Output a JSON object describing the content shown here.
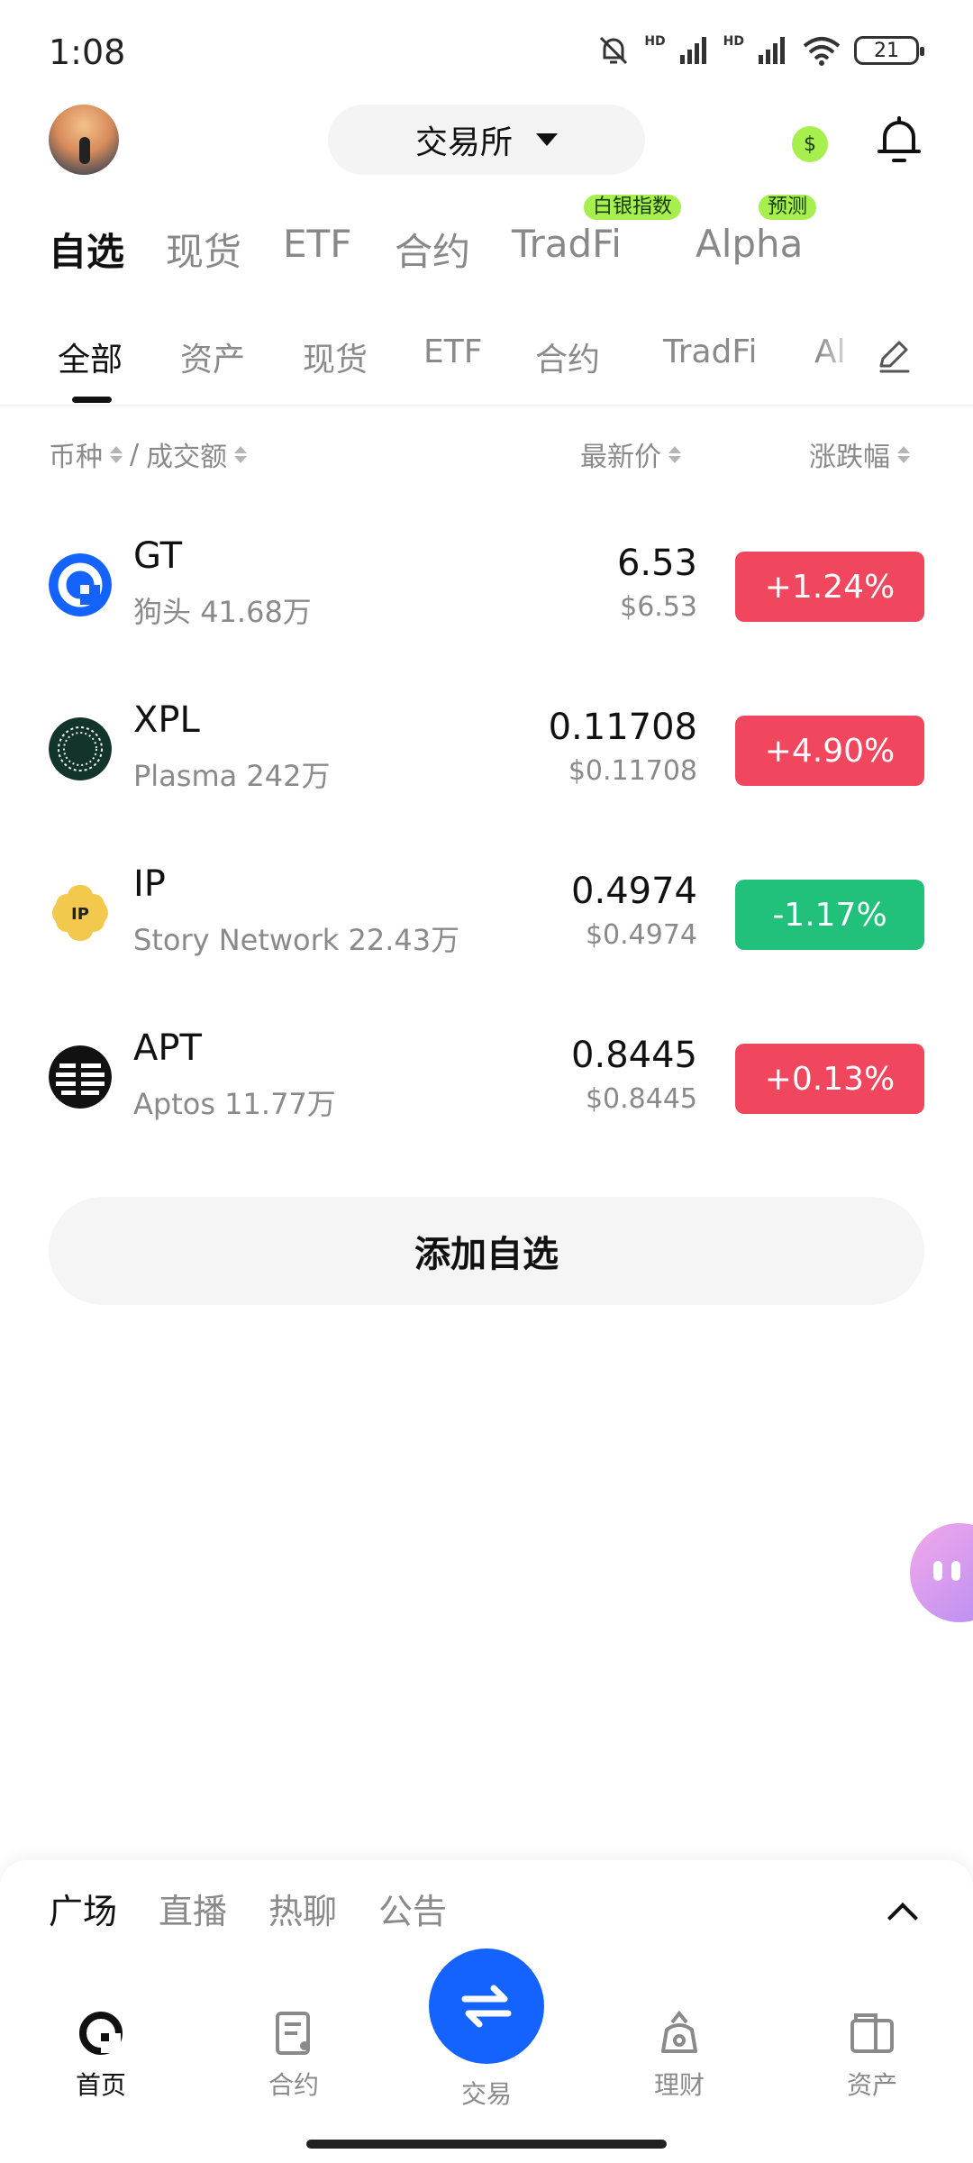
{
  "status_bar": {
    "time": "1:08",
    "battery": "21",
    "icons": [
      "mute-bell-icon",
      "signal-hd-icon",
      "signal-hd-icon",
      "wifi-icon",
      "battery-icon"
    ]
  },
  "header": {
    "exchange_label": "交易所",
    "coin_symbol": "$"
  },
  "primary_tabs": [
    {
      "label": "自选",
      "active": true
    },
    {
      "label": "现货"
    },
    {
      "label": "ETF"
    },
    {
      "label": "合约"
    },
    {
      "label": "TradFi",
      "badge": "白银指数"
    },
    {
      "label": "Alpha",
      "badge": "预测"
    }
  ],
  "secondary_tabs": [
    {
      "label": "全部",
      "active": true
    },
    {
      "label": "资产"
    },
    {
      "label": "现货"
    },
    {
      "label": "ETF"
    },
    {
      "label": "合约"
    },
    {
      "label": "TradFi"
    },
    {
      "label": "Al"
    }
  ],
  "columns": {
    "coin": "币种",
    "separator": "/",
    "volume": "成交额",
    "price": "最新价",
    "change": "涨跌幅"
  },
  "rows": [
    {
      "symbol": "GT",
      "name": "狗头",
      "volume": "41.68万",
      "price": "6.53",
      "usd": "$6.53",
      "change": "+1.24%",
      "direction": "up"
    },
    {
      "symbol": "XPL",
      "name": "Plasma",
      "volume": "242万",
      "price": "0.11708",
      "usd": "$0.11708",
      "change": "+4.90%",
      "direction": "up"
    },
    {
      "symbol": "IP",
      "name": "Story Network",
      "volume": "22.43万",
      "price": "0.4974",
      "usd": "$0.4974",
      "change": "-1.17%",
      "direction": "down"
    },
    {
      "symbol": "APT",
      "name": "Aptos",
      "volume": "11.77万",
      "price": "0.8445",
      "usd": "$0.8445",
      "change": "+0.13%",
      "direction": "up"
    }
  ],
  "add_button": "添加自选",
  "feed_tabs": [
    {
      "label": "广场",
      "active": true
    },
    {
      "label": "直播"
    },
    {
      "label": "热聊"
    },
    {
      "label": "公告"
    }
  ],
  "bottom_nav": [
    {
      "label": "首页",
      "icon": "home-icon",
      "active": true
    },
    {
      "label": "合约",
      "icon": "contract-icon"
    },
    {
      "label": "交易",
      "icon": "swap-icon"
    },
    {
      "label": "理财",
      "icon": "earn-icon"
    },
    {
      "label": "资产",
      "icon": "wallet-icon"
    }
  ],
  "colors": {
    "up": "#f0475e",
    "down": "#21c07b",
    "accent": "#1463ff",
    "badge": "#a6ef4d"
  }
}
